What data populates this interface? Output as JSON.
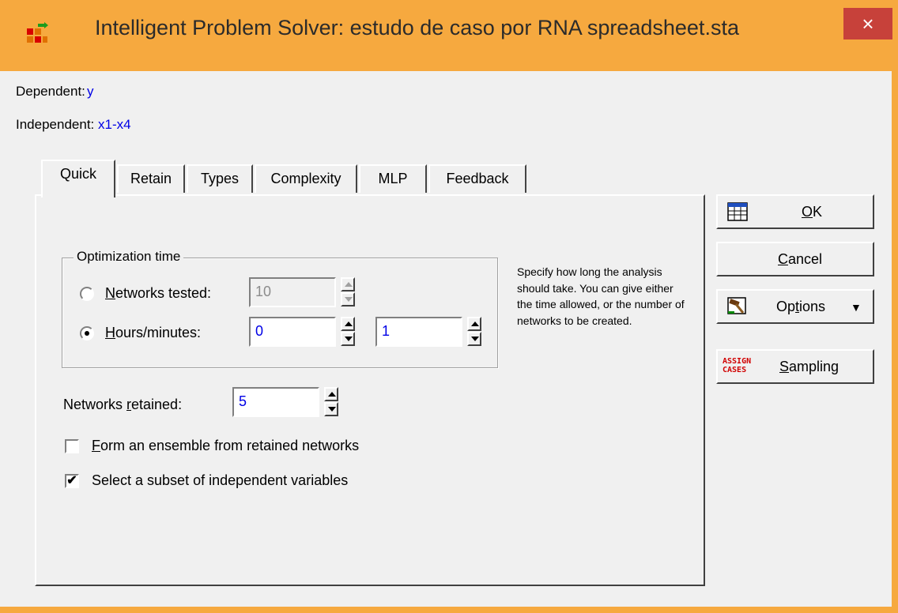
{
  "window": {
    "title": "Intelligent Problem Solver: estudo de caso por RNA spreadsheet.sta",
    "close_label": "×"
  },
  "variables": {
    "dependent_label": "Dependent:",
    "dependent_value": "y",
    "independent_label": "Independent:",
    "independent_value": "x1-x4"
  },
  "tabs": [
    {
      "label": "Quick",
      "active": true
    },
    {
      "label": "Retain"
    },
    {
      "label": "Types"
    },
    {
      "label": "Complexity"
    },
    {
      "label": "MLP"
    },
    {
      "label": "Feedback"
    }
  ],
  "optimization": {
    "group_title": "Optimization time",
    "networks_tested_label_ul": "N",
    "networks_tested_label_rest": "etworks tested:",
    "networks_tested_value": "10",
    "hours_label_ul": "H",
    "hours_label_rest": "ours/minutes:",
    "hours_value": "0",
    "minutes_value": "1",
    "selected": "hours"
  },
  "help_text": "Specify how long the analysis should take. You can give either the time allowed, or the number of networks to be created.",
  "retained": {
    "label_pre": "Networks ",
    "label_ul": "r",
    "label_post": "etained:",
    "value": "5"
  },
  "options": {
    "ensemble_ul": "F",
    "ensemble_rest": "orm an ensemble from retained networks",
    "ensemble_checked": false,
    "subset_label": "Select a subset of independent variables",
    "subset_checked": true,
    "check_mark": "✔"
  },
  "buttons": {
    "ok_ul": "O",
    "ok_rest": "K",
    "cancel_ul": "C",
    "cancel_rest": "ancel",
    "options_pre": "Op",
    "options_ul": "t",
    "options_post": "ions",
    "options_arrow": "▼",
    "sampling_ul": "S",
    "sampling_rest": "ampling",
    "assign_line1": "ASSIGN",
    "assign_line2": "CASES"
  },
  "colors": {
    "titlebar": "#f6a93f",
    "close": "#c7413a",
    "value_text": "#0000e6",
    "assign_icon": "#d00000"
  }
}
